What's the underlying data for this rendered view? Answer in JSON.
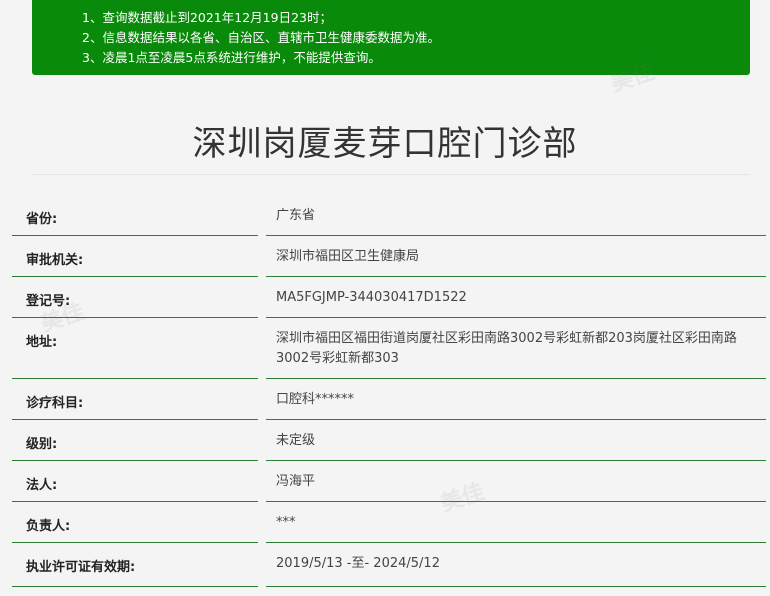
{
  "notice": {
    "lines": [
      "1、查询数据截止到2021年12月19日23时；",
      "2、信息数据结果以各省、自治区、直辖市卫生健康委数据为准。",
      "3、凌晨1点至凌晨5点系统进行维护，不能提供查询。"
    ]
  },
  "title": "深圳岗厦麦芽口腔门诊部",
  "fields": [
    {
      "label": "省份:",
      "value": "广东省"
    },
    {
      "label": "审批机关:",
      "value": "深圳市福田区卫生健康局"
    },
    {
      "label": "登记号:",
      "value": "MA5FGJMP-344030417D1522"
    },
    {
      "label": "地址:",
      "value": "深圳市福田区福田街道岗厦社区彩田南路3002号彩虹新都203岗厦社区彩田南路3002号彩虹新都303"
    },
    {
      "label": "诊疗科目:",
      "value": "口腔科******"
    },
    {
      "label": "级别:",
      "value": "未定级"
    },
    {
      "label": "法人:",
      "value": "冯海平"
    },
    {
      "label": "负责人:",
      "value": "***"
    },
    {
      "label": "执业许可证有效期:",
      "value": "2019/5/13 -至- 2024/5/12"
    }
  ],
  "watermark": "美佳"
}
